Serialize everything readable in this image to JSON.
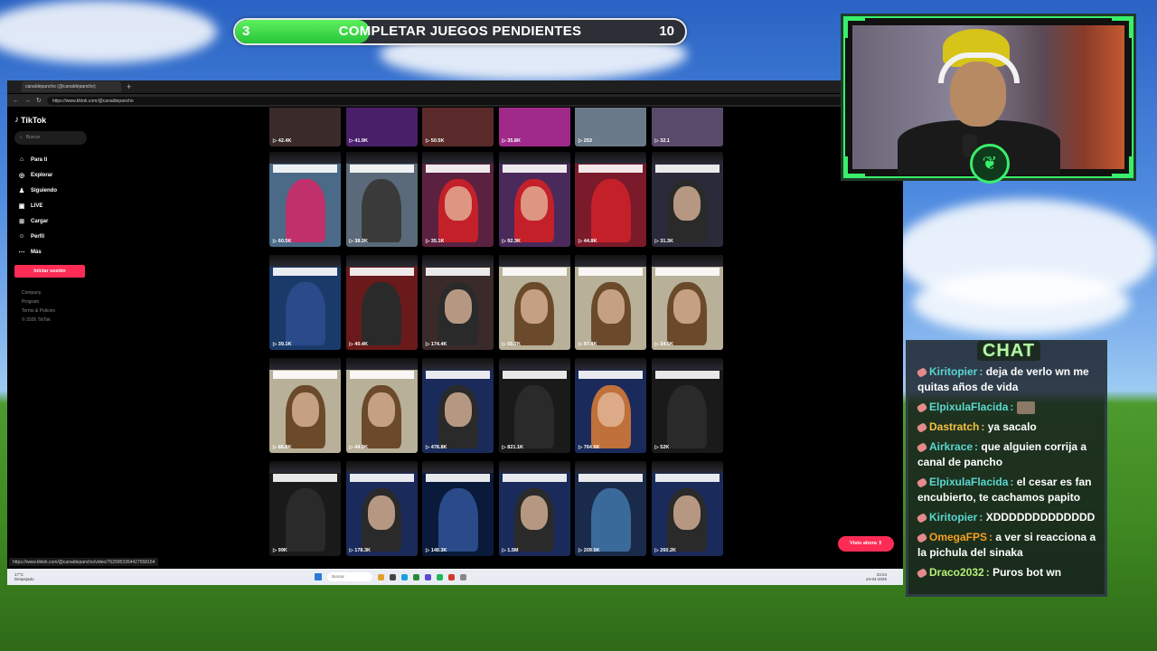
{
  "progress": {
    "start": "3",
    "end": "10",
    "label": "COMPLETAR JUEGOS PENDIENTES",
    "fraction": 0.3
  },
  "browser": {
    "tab_title": "canaldepancho (@canaldepancho)",
    "url": "https://www.tiktok.com/@canaldepancho",
    "status_url": "https://www.tiktok.com/@canaldepancho/video/7629953364427558164"
  },
  "tiktok": {
    "logo": "TikTok",
    "search_placeholder": "Buscar",
    "nav": [
      {
        "label": "Para ti",
        "icon": "home-icon"
      },
      {
        "label": "Explorar",
        "icon": "compass-icon"
      },
      {
        "label": "Siguiendo",
        "icon": "following-icon"
      },
      {
        "label": "LIVE",
        "icon": "live-icon"
      },
      {
        "label": "Cargar",
        "icon": "upload-icon"
      },
      {
        "label": "Perfil",
        "icon": "profile-icon"
      },
      {
        "label": "Más",
        "icon": "more-icon"
      }
    ],
    "login_label": "Iniciar sesión",
    "footer": [
      "Company",
      "Program",
      "Terms & Policies",
      "© 2026 TikTok"
    ],
    "visto_label": "Visto ahora",
    "videos": [
      {
        "views": "42.4K",
        "bg": "#3a2a2a",
        "face": false
      },
      {
        "views": "41.9K",
        "bg": "#4a1f6a",
        "face": false
      },
      {
        "views": "50.5K",
        "bg": "#5a2a2a",
        "face": false
      },
      {
        "views": "35.8K",
        "bg": "#a02a8a",
        "face": false
      },
      {
        "views": "253",
        "bg": "#6a7a8a",
        "face": false
      },
      {
        "views": "32.1",
        "bg": "#5a4a6a",
        "face": false
      },
      {
        "views": "60.5K",
        "bg": "#4a6a88",
        "face": false,
        "hair": "#c0306a"
      },
      {
        "views": "38.3K",
        "bg": "#5a6a7a",
        "face": false,
        "hair": "#3a3a3a"
      },
      {
        "views": "35.1K",
        "bg": "#5a2240",
        "face": true,
        "hair": "#c4202a"
      },
      {
        "views": "92.3K",
        "bg": "#4a2a5a",
        "face": true,
        "hair": "#c4202a"
      },
      {
        "views": "44.8K",
        "bg": "#7a1a2a",
        "face": false,
        "hair": "#c4202a"
      },
      {
        "views": "31.3K",
        "bg": "#2a2a3a",
        "face": true,
        "hair": "#2a2a2a"
      },
      {
        "views": "39.1K",
        "bg": "#1a3a6a",
        "face": false,
        "hair": "#2a4a8a"
      },
      {
        "views": "40.4K",
        "bg": "#6a1a1a",
        "face": false,
        "hair": "#2a2a2a"
      },
      {
        "views": "174.4K",
        "bg": "#3a2a2a",
        "face": true,
        "hair": "#2a2a2a"
      },
      {
        "views": "55.7K",
        "bg": "#b8b098",
        "face": true,
        "hair": "#6a4a2a"
      },
      {
        "views": "97.4K",
        "bg": "#b8b098",
        "face": true,
        "hair": "#6a4a2a"
      },
      {
        "views": "34.5K",
        "bg": "#b8b098",
        "face": true,
        "hair": "#6a4a2a"
      },
      {
        "views": "86.8K",
        "bg": "#b8b098",
        "face": true,
        "hair": "#6a4a2a"
      },
      {
        "views": "44.9K",
        "bg": "#b8b098",
        "face": true,
        "hair": "#6a4a2a"
      },
      {
        "views": "478.8K",
        "bg": "#1a2a5a",
        "face": true,
        "hair": "#2a2a2a"
      },
      {
        "views": "821.1K",
        "bg": "#1a1a1a",
        "face": false,
        "hair": "#2a2a2a"
      },
      {
        "views": "764.6K",
        "bg": "#1a2a5a",
        "face": true,
        "hair": "#c0703a"
      },
      {
        "views": "52K",
        "bg": "#1a1a1a",
        "face": false,
        "hair": "#2a2a2a"
      },
      {
        "views": "99K",
        "bg": "#1a1a1a",
        "face": false,
        "hair": "#2a2a2a"
      },
      {
        "views": "178.3K",
        "bg": "#1a2a5a",
        "face": true,
        "hair": "#2a2a2a"
      },
      {
        "views": "148.3K",
        "bg": "#0a1a3a",
        "face": false,
        "hair": "#2a4a8a"
      },
      {
        "views": "1.5M",
        "bg": "#1a2a5a",
        "face": true,
        "hair": "#2a2a2a"
      },
      {
        "views": "209.5K",
        "bg": "#1a2a4a",
        "face": false,
        "hair": "#3a6a9a"
      },
      {
        "views": "260.2K",
        "bg": "#1a2a5a",
        "face": true,
        "hair": "#2a2a2a"
      }
    ]
  },
  "taskbar": {
    "weather_temp": "17°C",
    "weather_desc": "Despejado",
    "search_placeholder": "Buscar",
    "lang": "ESP LAA",
    "time": "23:24",
    "date": "24-04-2026"
  },
  "chat": {
    "title": "CHAT",
    "messages": [
      {
        "user": "Kiritopier",
        "color": "#5ad7d0",
        "text": "deja de verlo wn me quitas años de vida"
      },
      {
        "user": "ElpixulaFlacida",
        "color": "#5ad7d0",
        "text": ""
      },
      {
        "user": "Dastratch",
        "color": "#f4c042",
        "text": "ya sacalo"
      },
      {
        "user": "Airkrace",
        "color": "#5ad7d0",
        "text": "que alguien corrija a canal de pancho"
      },
      {
        "user": "ElpixulaFlacida",
        "color": "#5ad7d0",
        "text": "el cesar es fan encubierto, te cachamos papito"
      },
      {
        "user": "Kiritopier",
        "color": "#5ad7d0",
        "text": "XDDDDDDDDDDDDD"
      },
      {
        "user": "OmegaFPS",
        "color": "#f4a020",
        "text": "a ver si reacciona a la pichula del sinaka"
      },
      {
        "user": "Draco2032",
        "color": "#b6f07a",
        "text": "Puros bot wn"
      }
    ]
  }
}
